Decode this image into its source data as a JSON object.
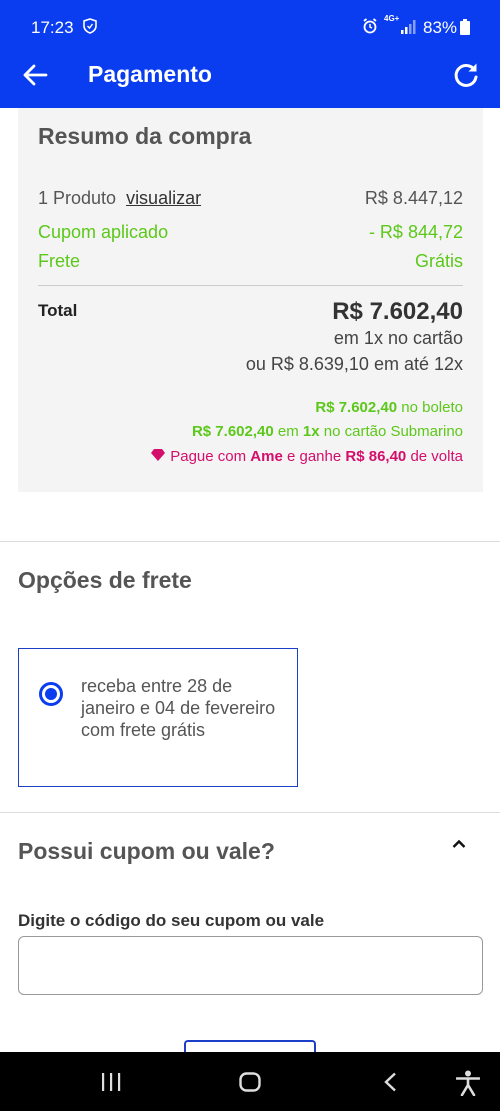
{
  "status_bar": {
    "time": "17:23",
    "network": "4G+",
    "battery": "83%"
  },
  "app_bar": {
    "title": "Pagamento"
  },
  "summary": {
    "heading": "Resumo da compra",
    "products_label": "1 Produto",
    "view_link": "visualizar",
    "products_value": "R$ 8.447,12",
    "coupon_label": "Cupom aplicado",
    "coupon_value": "- R$ 844,72",
    "shipping_label": "Frete",
    "shipping_value": "Grátis",
    "total_label": "Total",
    "total_value": "R$ 7.602,40",
    "total_terms": "em 1x no cartão",
    "installments": "ou R$ 8.639,10 em até 12x",
    "boleto_value": "R$ 7.602,40",
    "boleto_text": "no boleto",
    "card_value": "R$ 7.602,40",
    "card_em": "em",
    "card_times": "1x",
    "card_text": "no cartão Submarino",
    "ame_text1": "Pague com",
    "ame_brand": "Ame",
    "ame_text2": "e ganhe",
    "ame_value": "R$ 86,40",
    "ame_text3": "de volta"
  },
  "shipping_options": {
    "title": "Opções de frete",
    "option_text": "receba entre 28 de janeiro e 04 de fevereiro com frete grátis"
  },
  "coupon": {
    "title": "Possui cupom ou vale?",
    "field_label": "Digite o código do seu cupom ou vale",
    "value": "",
    "placeholder": ""
  },
  "colors": {
    "brand_blue": "#0a3df0",
    "green": "#5cc81a",
    "ame_pink": "#d40e6b"
  },
  "icons": [
    "shield-icon",
    "alarm-icon",
    "signal-icon",
    "battery-icon",
    "back-arrow-icon",
    "refresh-icon",
    "chevron-up-icon",
    "ame-diamond-icon",
    "recents-icon",
    "home-icon",
    "nav-back-icon",
    "accessibility-icon"
  ]
}
